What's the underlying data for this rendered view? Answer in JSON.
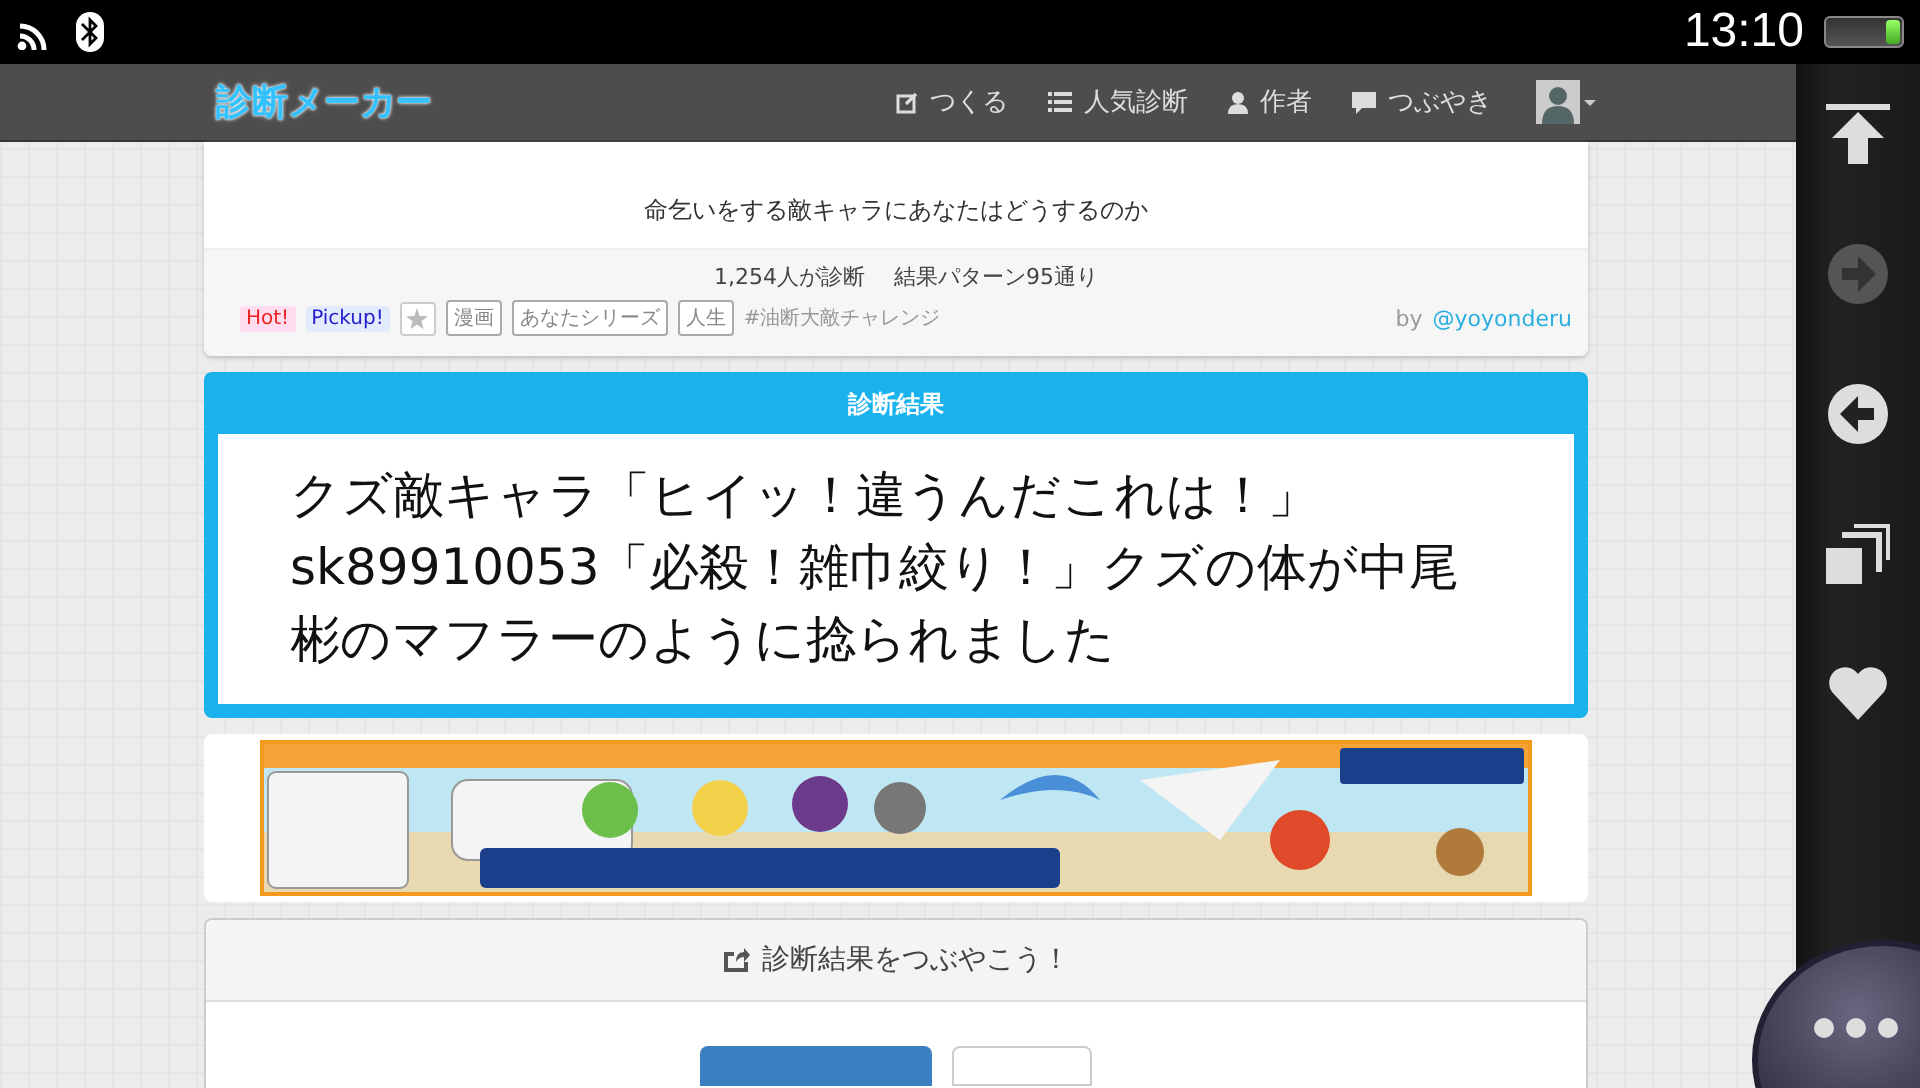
{
  "status_bar": {
    "time": "13:10",
    "battery": {
      "level": 0.2
    }
  },
  "nav": {
    "logo": "診断メーカー",
    "items": [
      {
        "kind": "create",
        "label": "つくる"
      },
      {
        "kind": "popular",
        "label": "人気診断"
      },
      {
        "kind": "author",
        "label": "作者"
      },
      {
        "kind": "tweet",
        "label": "つぶやき"
      }
    ]
  },
  "diagnosis": {
    "description": "命乞いをする敵キャラにあなたはどうするのか",
    "stats": "1,254人が診断　 結果パターン95通り",
    "tags": [
      {
        "kind": "hot",
        "label": "Hot!"
      },
      {
        "kind": "pickup",
        "label": "Pickup!"
      },
      {
        "kind": "star"
      },
      {
        "kind": "tag",
        "label": "漫画"
      },
      {
        "kind": "tag",
        "label": "あなたシリーズ"
      },
      {
        "kind": "tag",
        "label": "人生"
      },
      {
        "kind": "hashtag",
        "label": "#油断大敵チャレンジ"
      }
    ],
    "by": "by",
    "author": "@yoyonderu"
  },
  "result": {
    "title": "診断結果",
    "text": "クズ敵キャラ「ヒイッ！違うんだこれは！」 sk89910053「必殺！雑巾絞り！」クズの体が中尾彬のマフラーのように捻られました"
  },
  "share": {
    "title": "診断結果をつぶやこう！"
  },
  "sidebar": {
    "buttons": [
      {
        "kind": "top",
        "disabled": false
      },
      {
        "kind": "forward",
        "disabled": true
      },
      {
        "kind": "back",
        "disabled": false
      },
      {
        "kind": "tabs",
        "disabled": false
      },
      {
        "kind": "favorite",
        "disabled": false
      }
    ]
  }
}
